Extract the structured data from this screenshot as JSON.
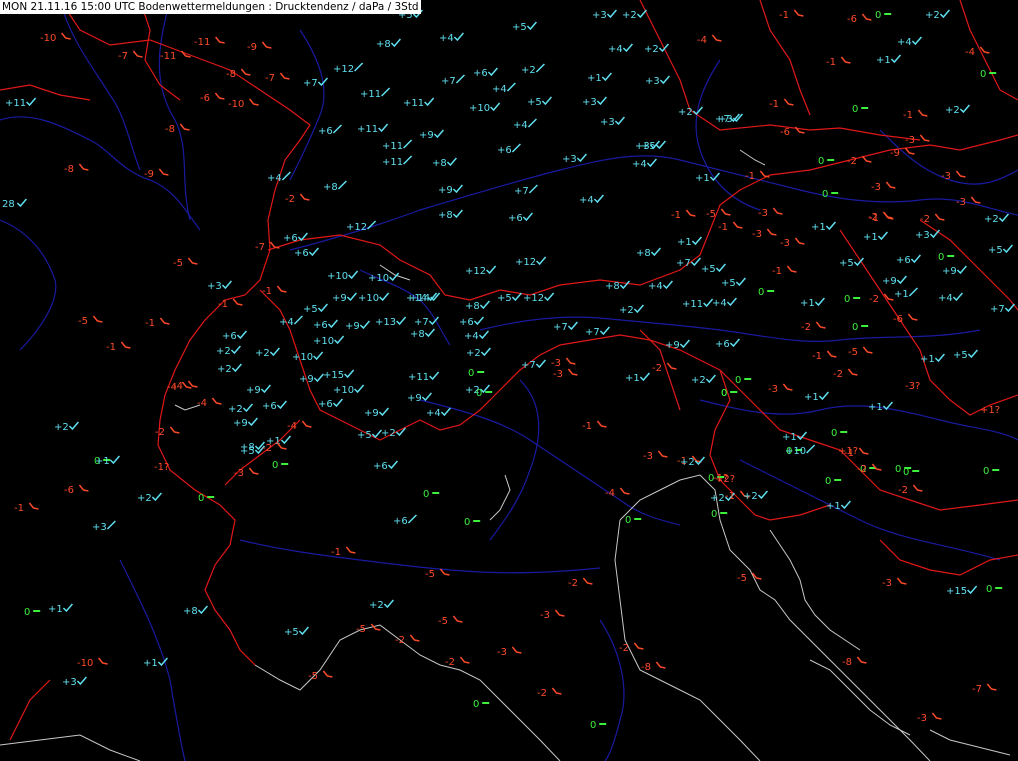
{
  "header": {
    "title": "MON 21.11.16 15:00 UTC  Bodenwettermeldungen :  Drucktendenz / daPa / 3Std"
  },
  "colors": {
    "positive": "#5fe0f0",
    "negative": "#ff4a2a",
    "neutral": "#3cf03c",
    "border": "#e01818",
    "river": "#1a1aa0",
    "coast": "#c8c8c8"
  },
  "stations": [
    {
      "v": "-10",
      "s": "dn"
    },
    {
      "v": "-7",
      "s": "dn"
    },
    {
      "v": "-11",
      "s": "dn"
    },
    {
      "v": "-11",
      "s": "dn"
    },
    {
      "v": "-9",
      "s": "dn"
    },
    {
      "v": "-8",
      "s": "dn"
    },
    {
      "v": "-7",
      "s": "dn"
    },
    {
      "v": "-6",
      "s": "dn"
    },
    {
      "v": "-10",
      "s": "dn"
    },
    {
      "v": "+11",
      "s": "ck"
    },
    {
      "v": "+7",
      "s": "ck"
    },
    {
      "v": "+12",
      "s": "up"
    },
    {
      "v": "+11",
      "s": "up"
    },
    {
      "v": "+11",
      "s": "ck"
    },
    {
      "v": "+8",
      "s": "ck"
    },
    {
      "v": "+4",
      "s": "ck"
    },
    {
      "v": "+5",
      "s": "ck"
    },
    {
      "v": "+5",
      "s": "ck"
    },
    {
      "v": "+3",
      "s": "ck"
    },
    {
      "v": "+2",
      "s": "ck"
    },
    {
      "v": "+7",
      "s": "up"
    },
    {
      "v": "+6",
      "s": "ck"
    },
    {
      "v": "+2",
      "s": "up"
    },
    {
      "v": "+4",
      "s": "up"
    },
    {
      "v": "+10",
      "s": "ck"
    },
    {
      "v": "+5",
      "s": "ck"
    },
    {
      "v": "+3",
      "s": "ck"
    },
    {
      "v": "+1",
      "s": "ck"
    },
    {
      "v": "+3",
      "s": "ck"
    },
    {
      "v": "+4",
      "s": "ck"
    },
    {
      "v": "+2",
      "s": "ck"
    },
    {
      "v": "-4",
      "s": "dn"
    },
    {
      "v": "-1",
      "s": "dn"
    },
    {
      "v": "-6",
      "s": "dn"
    },
    {
      "v": "0",
      "s": "z"
    },
    {
      "v": "+2",
      "s": "ck"
    },
    {
      "v": "+4",
      "s": "ck"
    },
    {
      "v": "+1",
      "s": "ck"
    },
    {
      "v": "-1",
      "s": "dn"
    },
    {
      "v": "0",
      "s": "z"
    },
    {
      "v": "-4",
      "s": "dn"
    },
    {
      "v": "-8",
      "s": "dn"
    },
    {
      "v": "+6",
      "s": "up"
    },
    {
      "v": "+11",
      "s": "ck"
    },
    {
      "v": "+9",
      "s": "ck"
    },
    {
      "v": "+4",
      "s": "up"
    },
    {
      "v": "+5",
      "s": "ck"
    },
    {
      "v": "+3",
      "s": "ck"
    },
    {
      "v": "+2",
      "s": "ck"
    },
    {
      "v": "+7",
      "s": "ck"
    },
    {
      "v": "+3",
      "s": "ck"
    },
    {
      "v": "-1",
      "s": "dn"
    },
    {
      "v": "-6",
      "s": "dn"
    },
    {
      "v": "0",
      "s": "z"
    },
    {
      "v": "-1",
      "s": "dn"
    },
    {
      "v": "+2",
      "s": "ck"
    },
    {
      "v": "-3",
      "s": "dn"
    },
    {
      "v": "-9",
      "s": "dn"
    },
    {
      "v": "-8",
      "s": "dn"
    },
    {
      "v": "-9",
      "s": "dn"
    },
    {
      "v": "+11",
      "s": "up"
    },
    {
      "v": "+11",
      "s": "up"
    },
    {
      "v": "+8",
      "s": "ck"
    },
    {
      "v": "+6",
      "s": "up"
    },
    {
      "v": "+3",
      "s": "ck"
    },
    {
      "v": "+3",
      "s": "ck"
    },
    {
      "v": "+4",
      "s": "ck"
    },
    {
      "v": "+4",
      "s": "up"
    },
    {
      "v": "+8",
      "s": "up"
    },
    {
      "v": "+9",
      "s": "ck"
    },
    {
      "v": "+7",
      "s": "up"
    },
    {
      "v": "+1",
      "s": "ck"
    },
    {
      "v": "-1",
      "s": "dn"
    },
    {
      "v": "0",
      "s": "z"
    },
    {
      "v": "-2",
      "s": "dn"
    },
    {
      "v": "-3",
      "s": "dn"
    },
    {
      "v": "-3",
      "s": "dn"
    },
    {
      "v": "28",
      "s": "ck"
    },
    {
      "v": "-2",
      "s": "dn"
    },
    {
      "v": "+8",
      "s": "ck"
    },
    {
      "v": "+6",
      "s": "ck"
    },
    {
      "v": "+4",
      "s": "ck"
    },
    {
      "v": "0",
      "s": "z"
    },
    {
      "v": "-1",
      "s": "dn"
    },
    {
      "v": "-5",
      "s": "dn"
    },
    {
      "v": "-3",
      "s": "dn"
    },
    {
      "v": "+12",
      "s": "up"
    },
    {
      "v": "-7",
      "s": "dn"
    },
    {
      "v": "+6",
      "s": "ck"
    },
    {
      "v": "+6",
      "s": "ck"
    },
    {
      "v": "-1",
      "s": "dn"
    },
    {
      "v": "-3",
      "s": "dn"
    },
    {
      "v": "+1",
      "s": "ck"
    },
    {
      "v": "-3",
      "s": "dn"
    },
    {
      "v": "-1",
      "s": "dn"
    },
    {
      "v": "-2",
      "s": "dn"
    },
    {
      "v": "+2",
      "s": "ck"
    },
    {
      "v": "+1",
      "s": "ck"
    },
    {
      "v": "+3",
      "s": "ck"
    },
    {
      "v": "-3",
      "s": "dn"
    },
    {
      "v": "+1",
      "s": "ck"
    },
    {
      "v": "-2",
      "s": "dn"
    },
    {
      "v": "-5",
      "s": "dn"
    },
    {
      "v": "+8",
      "s": "ck"
    },
    {
      "v": "+7",
      "s": "ck"
    },
    {
      "v": "+5",
      "s": "ck"
    },
    {
      "v": "+5",
      "s": "ck"
    },
    {
      "v": "+6",
      "s": "ck"
    },
    {
      "v": "0",
      "s": "z"
    },
    {
      "v": "+5",
      "s": "ck"
    },
    {
      "v": "+12",
      "s": "ck"
    },
    {
      "v": "+12",
      "s": "ck"
    },
    {
      "v": "+8",
      "s": "ck"
    },
    {
      "v": "+4",
      "s": "ck"
    },
    {
      "v": "0",
      "s": "z"
    },
    {
      "v": "-1",
      "s": "dn"
    },
    {
      "v": "+5",
      "s": "ck"
    },
    {
      "v": "+9",
      "s": "ck"
    },
    {
      "v": "+9",
      "s": "ck"
    },
    {
      "v": "+3",
      "s": "ck"
    },
    {
      "v": "+10",
      "s": "ck"
    },
    {
      "v": "+10",
      "s": "ck"
    },
    {
      "v": "+14",
      "s": "ck"
    },
    {
      "v": "+8",
      "s": "ck"
    },
    {
      "v": "+5",
      "s": "ck"
    },
    {
      "v": "+12",
      "s": "ck"
    },
    {
      "v": "+11",
      "s": "ck"
    },
    {
      "v": "+4",
      "s": "ck"
    },
    {
      "v": "+1",
      "s": "ck"
    },
    {
      "v": "0",
      "s": "z"
    },
    {
      "v": "-2",
      "s": "dn"
    },
    {
      "v": "+4",
      "s": "ck"
    },
    {
      "v": "-1",
      "s": "dn"
    },
    {
      "v": "-1",
      "s": "dn"
    },
    {
      "v": "+5",
      "s": "ck"
    },
    {
      "v": "+10",
      "s": "ck"
    },
    {
      "v": "+9",
      "s": "ck"
    },
    {
      "v": "+9",
      "s": "ck"
    },
    {
      "v": "+1",
      "s": "up"
    },
    {
      "v": "0",
      "s": "z"
    },
    {
      "v": "-6",
      "s": "dn"
    },
    {
      "v": "+7",
      "s": "ck"
    },
    {
      "v": "-5",
      "s": "dn"
    },
    {
      "v": "-1",
      "s": "dn"
    },
    {
      "v": "+6",
      "s": "ck"
    },
    {
      "v": "+4",
      "s": "up"
    },
    {
      "v": "+6",
      "s": "ck"
    },
    {
      "v": "+13",
      "s": "ck"
    },
    {
      "v": "+7",
      "s": "ck"
    },
    {
      "v": "+6",
      "s": "ck"
    },
    {
      "v": "+7",
      "s": "ck"
    },
    {
      "v": "+7",
      "s": "ck"
    },
    {
      "v": "+2",
      "s": "ck"
    },
    {
      "v": "-2",
      "s": "dn"
    },
    {
      "v": "-4",
      "s": "dn"
    },
    {
      "v": "+2",
      "s": "ck"
    },
    {
      "v": "+2",
      "s": "ck"
    },
    {
      "v": "+10",
      "s": "ck"
    },
    {
      "v": "+10",
      "s": "ck"
    },
    {
      "v": "+14",
      "s": "ck"
    },
    {
      "v": "+8",
      "s": "ck"
    },
    {
      "v": "+4",
      "s": "ck"
    },
    {
      "v": "+2",
      "s": "ck"
    },
    {
      "v": "+9",
      "s": "ck"
    },
    {
      "v": "+6",
      "s": "ck"
    },
    {
      "v": "-5",
      "s": "dn"
    },
    {
      "v": "+5",
      "s": "ck"
    },
    {
      "v": "-1",
      "s": "dn"
    },
    {
      "v": "+2",
      "s": "ck"
    },
    {
      "v": "+9",
      "s": "ck"
    },
    {
      "v": "+15",
      "s": "ck"
    },
    {
      "v": "+11",
      "s": "ck"
    },
    {
      "v": "0",
      "s": "z"
    },
    {
      "v": "+7",
      "s": "ck"
    },
    {
      "v": "-3",
      "s": "dn"
    },
    {
      "v": "+1",
      "s": "ck"
    },
    {
      "v": "-2",
      "s": "dn"
    },
    {
      "v": "+2",
      "s": "ck"
    },
    {
      "v": "0",
      "s": "z"
    },
    {
      "v": "-1",
      "s": "dn"
    },
    {
      "v": "-2",
      "s": "dn"
    },
    {
      "v": "+1",
      "s": "ck"
    },
    {
      "v": "-3?",
      "s": "q"
    },
    {
      "v": "-4",
      "s": "dn"
    },
    {
      "v": "+9",
      "s": "ck"
    },
    {
      "v": "+10",
      "s": "ck"
    },
    {
      "v": "+2",
      "s": "ck"
    },
    {
      "v": "+9",
      "s": "ck"
    },
    {
      "v": "0",
      "s": "z"
    },
    {
      "v": "-3",
      "s": "dn"
    },
    {
      "v": "0",
      "s": "z"
    },
    {
      "v": "+1",
      "s": "ck"
    },
    {
      "v": "-3",
      "s": "dn"
    },
    {
      "v": "-4",
      "s": "dn"
    },
    {
      "v": "+2",
      "s": "ck"
    },
    {
      "v": "+6",
      "s": "ck"
    },
    {
      "v": "+6",
      "s": "ck"
    },
    {
      "v": "+9",
      "s": "ck"
    },
    {
      "v": "+4",
      "s": "ck"
    },
    {
      "v": "+1",
      "s": "ck"
    },
    {
      "v": "+1?",
      "s": "q"
    },
    {
      "v": "0",
      "s": "z"
    },
    {
      "v": "+2",
      "s": "ck"
    },
    {
      "v": "-2",
      "s": "dn"
    },
    {
      "v": "+9",
      "s": "ck"
    },
    {
      "v": "-4",
      "s": "dn"
    },
    {
      "v": "+5",
      "s": "ck"
    },
    {
      "v": "+2",
      "s": "ck"
    },
    {
      "v": "-1",
      "s": "dn"
    },
    {
      "v": "0",
      "s": "z"
    },
    {
      "v": "+1",
      "s": "ck"
    },
    {
      "v": "+1?",
      "s": "q"
    },
    {
      "v": "+8",
      "s": "ck"
    },
    {
      "v": "+1",
      "s": "ck"
    },
    {
      "v": "0",
      "s": "z"
    },
    {
      "v": "+6",
      "s": "ck"
    },
    {
      "v": "0",
      "s": "z"
    },
    {
      "v": "0",
      "s": "z"
    },
    {
      "v": "-1",
      "s": "dn"
    },
    {
      "v": "-1?",
      "s": "q"
    },
    {
      "v": "0",
      "s": "z"
    },
    {
      "v": "-1",
      "s": "dn"
    },
    {
      "v": "+5",
      "s": "ck"
    },
    {
      "v": "-2",
      "s": "dn"
    },
    {
      "v": "-3",
      "s": "dn"
    },
    {
      "v": "0",
      "s": "z"
    },
    {
      "v": "+10",
      "s": "up"
    },
    {
      "v": "0",
      "s": "z"
    },
    {
      "v": "+2",
      "s": "ck"
    },
    {
      "v": "0",
      "s": "z"
    },
    {
      "v": "0",
      "s": "z"
    },
    {
      "v": "0",
      "s": "z"
    },
    {
      "v": "+1",
      "s": "ck"
    },
    {
      "v": "-1?",
      "s": "q"
    },
    {
      "v": "-3",
      "s": "dn"
    },
    {
      "v": "+2",
      "s": "ck"
    },
    {
      "v": "-6",
      "s": "dn"
    },
    {
      "v": "-4",
      "s": "dn"
    },
    {
      "v": "+2",
      "s": "ck"
    },
    {
      "v": "-1",
      "s": "dn"
    },
    {
      "v": "+2",
      "s": "ck"
    },
    {
      "v": "+2?",
      "s": "q"
    },
    {
      "v": "0",
      "s": "z"
    },
    {
      "v": "-2",
      "s": "dn"
    },
    {
      "v": "-2",
      "s": "dn"
    },
    {
      "v": "-1",
      "s": "dn"
    },
    {
      "v": "+3",
      "s": "up"
    },
    {
      "v": "+6",
      "s": "up"
    },
    {
      "v": "0",
      "s": "z"
    },
    {
      "v": "0",
      "s": "z"
    },
    {
      "v": "0",
      "s": "z"
    },
    {
      "v": "+1",
      "s": "ck"
    },
    {
      "v": "0",
      "s": "z"
    },
    {
      "v": "-1",
      "s": "dn"
    },
    {
      "v": "-5",
      "s": "dn"
    },
    {
      "v": "-2",
      "s": "dn"
    },
    {
      "v": "-5",
      "s": "dn"
    },
    {
      "v": "-3",
      "s": "dn"
    },
    {
      "v": "+15",
      "s": "ck"
    },
    {
      "v": "0",
      "s": "z"
    },
    {
      "v": "0",
      "s": "z"
    },
    {
      "v": "+1",
      "s": "ck"
    },
    {
      "v": "+8",
      "s": "ck"
    },
    {
      "v": "+2",
      "s": "ck"
    },
    {
      "v": "-3",
      "s": "dn"
    },
    {
      "v": "+5",
      "s": "ck"
    },
    {
      "v": "-5",
      "s": "dn"
    },
    {
      "v": "-2",
      "s": "dn"
    },
    {
      "v": "-5",
      "s": "dn"
    },
    {
      "v": "-2",
      "s": "dn"
    },
    {
      "v": "-3",
      "s": "dn"
    },
    {
      "v": "-2",
      "s": "dn"
    },
    {
      "v": "-8",
      "s": "dn"
    },
    {
      "v": "-8",
      "s": "dn"
    },
    {
      "v": "-10",
      "s": "dn"
    },
    {
      "v": "+1",
      "s": "ck"
    },
    {
      "v": "+3",
      "s": "ck"
    },
    {
      "v": "-5",
      "s": "dn"
    },
    {
      "v": "0",
      "s": "z"
    },
    {
      "v": "0",
      "s": "z"
    },
    {
      "v": "-2",
      "s": "dn"
    },
    {
      "v": "-3",
      "s": "dn"
    },
    {
      "v": "-7",
      "s": "dn"
    }
  ]
}
